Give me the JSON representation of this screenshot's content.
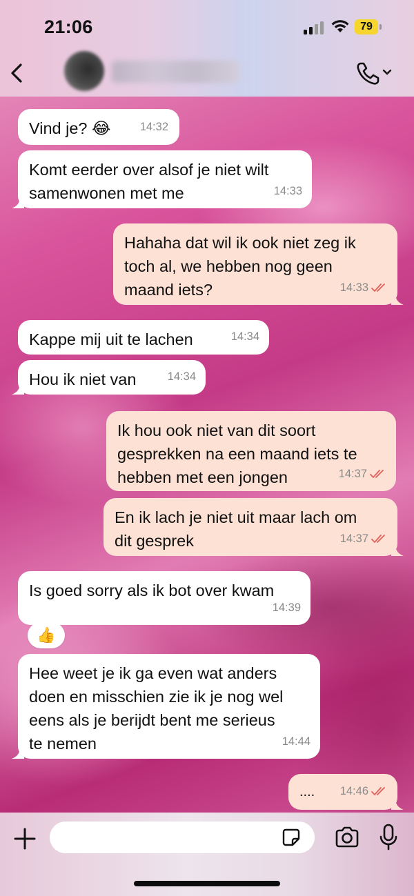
{
  "status_bar": {
    "time": "21:06",
    "battery_level": "79"
  },
  "header": {
    "back_icon": "chevron-left-icon",
    "contact_name": "",
    "call_icon": "phone-icon"
  },
  "messages": [
    {
      "dir": "in",
      "text": "Vind je? 😂",
      "time": "14:32"
    },
    {
      "dir": "in",
      "text": "Komt eerder over alsof je niet wilt\nsamenwonen met me",
      "time": "14:33"
    },
    {
      "dir": "out",
      "text": "Hahaha dat wil ik ook niet zeg ik\ntoch al, we hebben nog geen\nmaand iets?",
      "time": "14:33",
      "read": true
    },
    {
      "dir": "in",
      "text": "Kappe mij uit te lachen",
      "time": "14:34"
    },
    {
      "dir": "in",
      "text": "Hou ik niet van",
      "time": "14:34"
    },
    {
      "dir": "out",
      "text": "Ik hou ook niet van dit soort\ngesprekken na een maand iets te\nhebben met een jongen",
      "time": "14:37",
      "read": true
    },
    {
      "dir": "out",
      "text": "En ik lach je niet uit maar lach om\ndit gesprek",
      "time": "14:37",
      "read": true
    },
    {
      "dir": "in",
      "text": "Is goed sorry als ik bot over kwam",
      "time": "14:39",
      "reaction": "👍"
    },
    {
      "dir": "in",
      "text": "Hee weet je ik ga even wat anders\ndoen en misschien zie ik je nog wel\neens als je berijdt bent me serieus\nte nemen",
      "time": "14:44"
    },
    {
      "dir": "out",
      "text": "....",
      "time": "14:46",
      "read": true
    }
  ],
  "composer": {
    "placeholder": "",
    "icons": [
      "plus-icon",
      "sticker-icon",
      "camera-icon",
      "microphone-icon"
    ]
  },
  "colors": {
    "incoming_bubble": "#ffffff",
    "outgoing_bubble": "#fde1d4",
    "read_tick": "#e0605a",
    "timestamp": "#8a8a8a"
  }
}
